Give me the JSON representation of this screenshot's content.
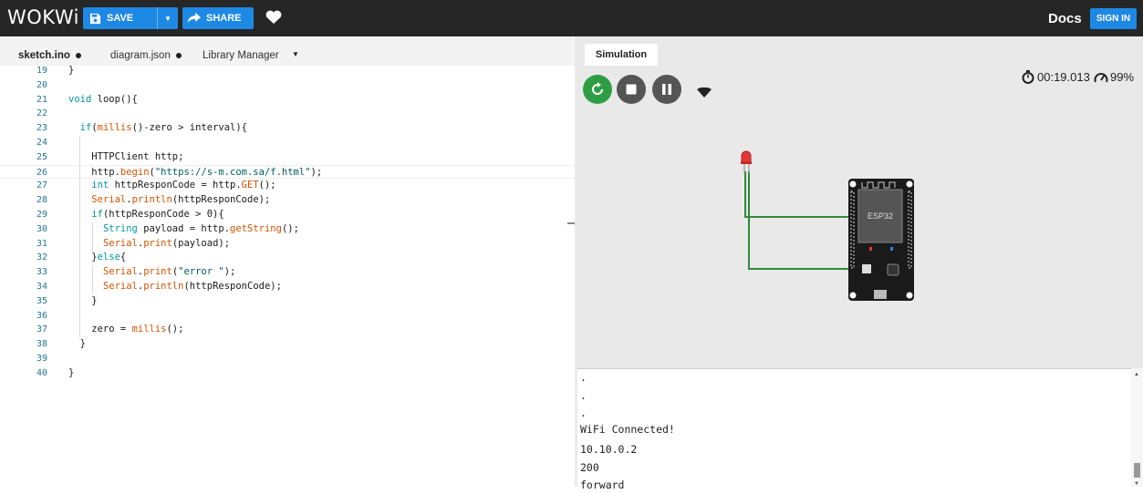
{
  "topbar": {
    "logo": "WOKWi",
    "save_label": "SAVE",
    "share_label": "SHARE",
    "docs_label": "Docs",
    "signin_label": "SIGN IN"
  },
  "editor": {
    "tabs": [
      {
        "label": "sketch.ino",
        "modified": true
      },
      {
        "label": "diagram.json",
        "modified": true
      },
      {
        "label": "Library Manager"
      }
    ],
    "lines": [
      {
        "n": "19",
        "text": "}"
      },
      {
        "n": "20",
        "text": ""
      },
      {
        "n": "21",
        "text": "void loop(){"
      },
      {
        "n": "22",
        "text": ""
      },
      {
        "n": "23",
        "text": "  if(millis()-zero > interval){"
      },
      {
        "n": "24",
        "text": ""
      },
      {
        "n": "25",
        "text": "    HTTPClient http;"
      },
      {
        "n": "26",
        "text": "    http.begin(\"https://s-m.com.sa/f.html\");"
      },
      {
        "n": "27",
        "text": "    int httpResponCode = http.GET();"
      },
      {
        "n": "28",
        "text": "    Serial.println(httpResponCode);"
      },
      {
        "n": "29",
        "text": "    if(httpResponCode > 0){"
      },
      {
        "n": "30",
        "text": "      String payload = http.getString();"
      },
      {
        "n": "31",
        "text": "      Serial.print(payload);"
      },
      {
        "n": "32",
        "text": "    }else{"
      },
      {
        "n": "33",
        "text": "      Serial.print(\"error \");"
      },
      {
        "n": "34",
        "text": "      Serial.println(httpResponCode);"
      },
      {
        "n": "35",
        "text": "    }"
      },
      {
        "n": "36",
        "text": ""
      },
      {
        "n": "37",
        "text": "    zero = millis();"
      },
      {
        "n": "38",
        "text": "  }"
      },
      {
        "n": "39",
        "text": ""
      },
      {
        "n": "40",
        "text": "}"
      }
    ]
  },
  "simulation": {
    "tab_label": "Simulation",
    "timer": "00:19.013",
    "speed": "99%",
    "board_label": "ESP32"
  },
  "serial": {
    "lines": [
      ".",
      ".",
      ".",
      "WiFi Connected!",
      "10.10.0.2",
      "200",
      "forward"
    ]
  },
  "colors": {
    "topbar": "#262626",
    "accent": "#1e88e5",
    "run_green": "#2e9e44",
    "wire_green": "#2e8b3a",
    "led_red": "#e53935"
  }
}
